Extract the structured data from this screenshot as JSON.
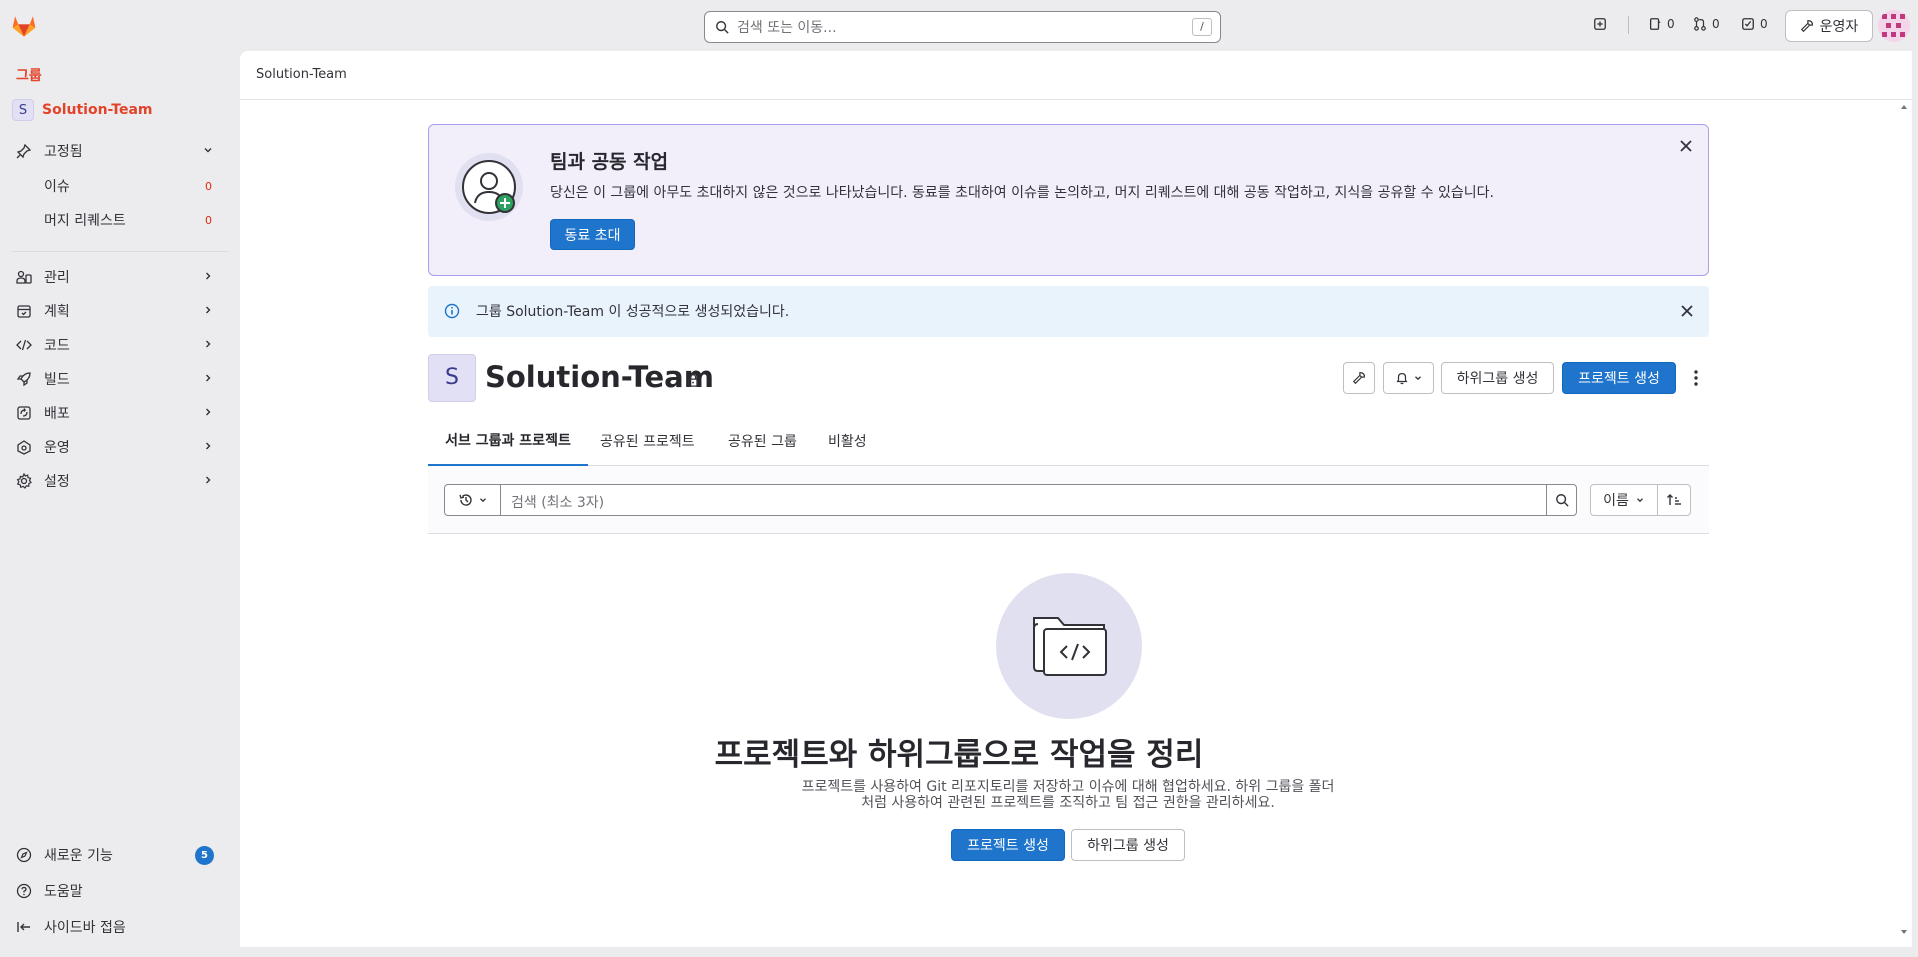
{
  "search": {
    "placeholder": "검색 또는 이동...",
    "shortcut": "/"
  },
  "topbar": {
    "issues_count": "0",
    "mr_count": "0",
    "todo_count": "0",
    "admin_label": "운영자"
  },
  "sidebar": {
    "context_label": "그룹",
    "group_name": "Solution-Team",
    "group_initial": "S",
    "pinned_label": "고정됨",
    "pinned_items": [
      {
        "label": "이슈",
        "count": "0"
      },
      {
        "label": "머지 리퀘스트",
        "count": "0"
      }
    ],
    "items": [
      {
        "label": "관리",
        "icon": "users-icon"
      },
      {
        "label": "계획",
        "icon": "calendar-icon"
      },
      {
        "label": "코드",
        "icon": "code-icon"
      },
      {
        "label": "빌드",
        "icon": "rocket-icon"
      },
      {
        "label": "배포",
        "icon": "deploy-icon"
      },
      {
        "label": "운영",
        "icon": "monitor-icon"
      },
      {
        "label": "설정",
        "icon": "gear-icon"
      }
    ],
    "whats_new_label": "새로운 기능",
    "whats_new_count": "5",
    "help_label": "도움말",
    "collapse_label": "사이드바 접음"
  },
  "breadcrumb": {
    "current": "Solution-Team"
  },
  "invite_banner": {
    "title": "팀과 공동 작업",
    "text": "당신은 이 그룹에 아무도 초대하지 않은 것으로 나타났습니다. 동료를 초대하여 이슈를 논의하고, 머지 리퀘스트에 대해 공동 작업하고, 지식을 공유할 수 있습니다.",
    "button": "동료 초대"
  },
  "alert": {
    "text": "그룹 Solution-Team 이 성공적으로 생성되었습니다."
  },
  "group_header": {
    "initial": "S",
    "name": "Solution-Team",
    "new_subgroup": "하위그룹 생성",
    "new_project": "프로젝트 생성"
  },
  "tabs": [
    {
      "label": "서브 그룹과 프로젝트",
      "active": true
    },
    {
      "label": "공유된 프로젝트",
      "active": false
    },
    {
      "label": "공유된 그룹",
      "active": false
    },
    {
      "label": "비활성",
      "active": false
    }
  ],
  "filter": {
    "search_placeholder": "검색 (최소 3자)",
    "sort_label": "이름"
  },
  "empty_state": {
    "title": "프로젝트와 하위그룹으로 작업을 정리",
    "line1": "프로젝트를 사용하여 Git 리포지토리를 저장하고 이슈에 대해 협업하세요. 하위 그룹을 폴더",
    "line2": "처럼 사용하여 관련된 프로젝트를 조직하고 팀 접근 권한을 관리하세요.",
    "new_project": "프로젝트 생성",
    "new_subgroup": "하위그룹 생성"
  },
  "colors": {
    "brand": "#e24329",
    "primary": "#1f75cb",
    "promo_bg": "#f2effa",
    "alert_bg": "#e9f3fc"
  }
}
